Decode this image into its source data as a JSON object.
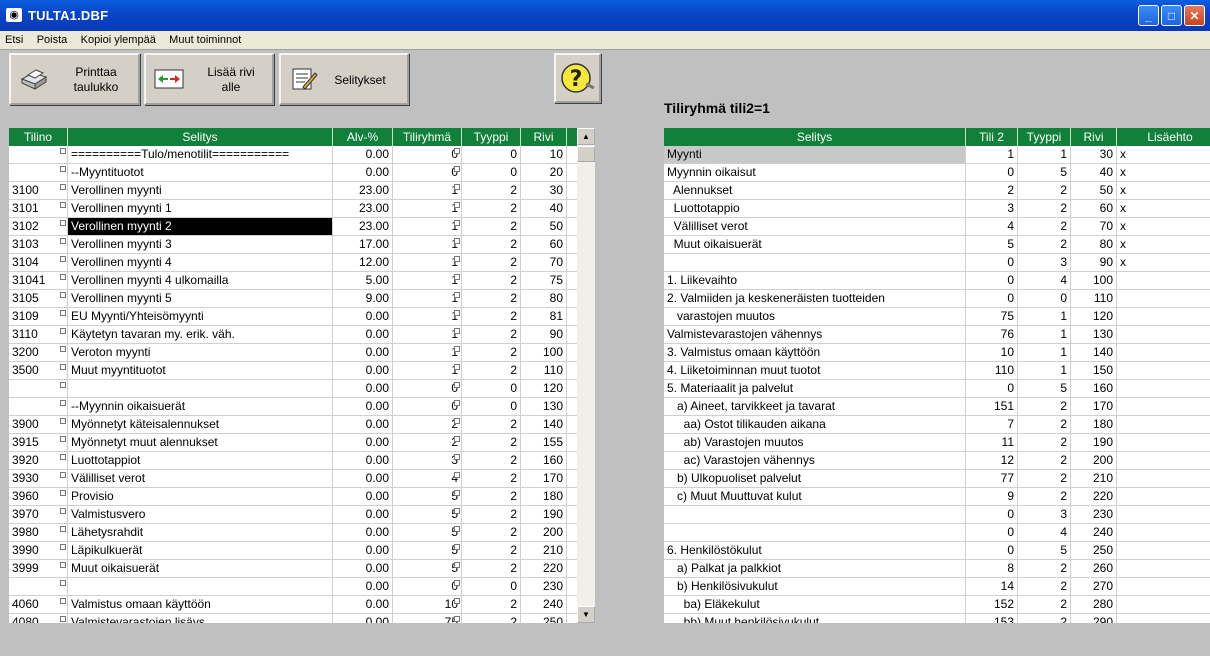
{
  "window": {
    "title": "TULTA1.DBF",
    "min": "_",
    "max": "□",
    "close": "✕"
  },
  "menu": [
    "Etsi",
    "Poista",
    "Kopioi ylempää",
    "Muut toiminnot"
  ],
  "toolbar": {
    "print": {
      "line1": "Printtaa",
      "line2": "taulukko"
    },
    "add": {
      "line1": "Lisää rivi",
      "line2": "alle"
    },
    "explain": {
      "label": "Selitykset"
    },
    "help": {
      "icon": "?"
    }
  },
  "right_title": "Tiliryhmä tili2=1",
  "left_table": {
    "columns": [
      "Tilino",
      "Selitys",
      "Alv-%",
      "Tiliryhmä",
      "Tyyppi",
      "Rivi"
    ],
    "selected_row": 4,
    "rows": [
      [
        "",
        "==========Tulo/menotilit===========",
        "0.00",
        "0",
        "0",
        "10"
      ],
      [
        "",
        "--Myyntituotot",
        "0.00",
        "0",
        "0",
        "20"
      ],
      [
        "3100",
        "Verollinen myynti",
        "23.00",
        "1",
        "2",
        "30"
      ],
      [
        "3101",
        "Verollinen myynti 1",
        "23.00",
        "1",
        "2",
        "40"
      ],
      [
        "3102",
        "Verollinen myynti 2",
        "23.00",
        "1",
        "2",
        "50"
      ],
      [
        "3103",
        "Verollinen myynti 3",
        "17.00",
        "1",
        "2",
        "60"
      ],
      [
        "3104",
        "Verollinen myynti 4",
        "12.00",
        "1",
        "2",
        "70"
      ],
      [
        "31041",
        "Verollinen myynti 4 ulkomailla",
        "5.00",
        "1",
        "2",
        "75"
      ],
      [
        "3105",
        "Verollinen myynti 5",
        "9.00",
        "1",
        "2",
        "80"
      ],
      [
        "3109",
        "EU Myynti/Yhteisömyynti",
        "0.00",
        "1",
        "2",
        "81"
      ],
      [
        "3110",
        "Käytetyn tavaran my. erik. väh.",
        "0.00",
        "1",
        "2",
        "90"
      ],
      [
        "3200",
        "Veroton myynti",
        "0.00",
        "1",
        "2",
        "100"
      ],
      [
        "3500",
        "Muut myyntituotot",
        "0.00",
        "1",
        "2",
        "110"
      ],
      [
        "",
        "",
        "0.00",
        "0",
        "0",
        "120"
      ],
      [
        "",
        "--Myynnin oikaisuerät",
        "0.00",
        "0",
        "0",
        "130"
      ],
      [
        "3900",
        "Myönnetyt käteisalennukset",
        "0.00",
        "2",
        "2",
        "140"
      ],
      [
        "3915",
        "Myönnetyt muut alennukset",
        "0.00",
        "2",
        "2",
        "155"
      ],
      [
        "3920",
        "Luottotappiot",
        "0.00",
        "3",
        "2",
        "160"
      ],
      [
        "3930",
        "Välilliset verot",
        "0.00",
        "4",
        "2",
        "170"
      ],
      [
        "3960",
        "Provisio",
        "0.00",
        "5",
        "2",
        "180"
      ],
      [
        "3970",
        "Valmistusvero",
        "0.00",
        "5",
        "2",
        "190"
      ],
      [
        "3980",
        "Lähetysrahdit",
        "0.00",
        "5",
        "2",
        "200"
      ],
      [
        "3990",
        "Läpikulkuerät",
        "0.00",
        "5",
        "2",
        "210"
      ],
      [
        "3999",
        "Muut oikaisuerät",
        "0.00",
        "5",
        "2",
        "220"
      ],
      [
        "",
        "",
        "0.00",
        "0",
        "0",
        "230"
      ],
      [
        "4060",
        "Valmistus omaan käyttöön",
        "0.00",
        "10",
        "2",
        "240"
      ],
      [
        "4080",
        "Valmistevarastojen lisäys",
        "0.00",
        "75",
        "2",
        "250"
      ]
    ]
  },
  "right_table": {
    "columns": [
      "Selitys",
      "Tili 2",
      "Tyyppi",
      "Rivi",
      "Lisäehto"
    ],
    "rows": [
      [
        "Myynti",
        "1",
        "1",
        "30",
        "x"
      ],
      [
        "Myynnin oikaisut",
        "0",
        "5",
        "40",
        "x"
      ],
      [
        "  Alennukset",
        "2",
        "2",
        "50",
        "x"
      ],
      [
        "  Luottotappio",
        "3",
        "2",
        "60",
        "x"
      ],
      [
        "  Välilliset verot",
        "4",
        "2",
        "70",
        "x"
      ],
      [
        "  Muut oikaisuerät",
        "5",
        "2",
        "80",
        "x"
      ],
      [
        "",
        "0",
        "3",
        "90",
        "x"
      ],
      [
        "1. Liikevaihto",
        "0",
        "4",
        "100",
        ""
      ],
      [
        "2. Valmiiden ja keskeneräisten tuotteiden",
        "0",
        "0",
        "110",
        ""
      ],
      [
        "   varastojen muutos",
        "75",
        "1",
        "120",
        ""
      ],
      [
        "Valmistevarastojen vähennys",
        "76",
        "1",
        "130",
        ""
      ],
      [
        "3. Valmistus omaan käyttöön",
        "10",
        "1",
        "140",
        ""
      ],
      [
        "4. Liiketoiminnan muut tuotot",
        "110",
        "1",
        "150",
        ""
      ],
      [
        "5. Materiaalit ja palvelut",
        "0",
        "5",
        "160",
        ""
      ],
      [
        "   a) Aineet, tarvikkeet ja tavarat",
        "151",
        "2",
        "170",
        ""
      ],
      [
        "     aa) Ostot tilikauden aikana",
        "7",
        "2",
        "180",
        ""
      ],
      [
        "     ab) Varastojen muutos",
        "11",
        "2",
        "190",
        ""
      ],
      [
        "     ac) Varastojen vähennys",
        "12",
        "2",
        "200",
        ""
      ],
      [
        "   b) Ulkopuoliset palvelut",
        "77",
        "2",
        "210",
        ""
      ],
      [
        "   c) Muut Muuttuvat kulut",
        "9",
        "2",
        "220",
        ""
      ],
      [
        "",
        "0",
        "3",
        "230",
        ""
      ],
      [
        "",
        "0",
        "4",
        "240",
        ""
      ],
      [
        "6. Henkilöstökulut",
        "0",
        "5",
        "250",
        ""
      ],
      [
        "   a) Palkat ja palkkiot",
        "8",
        "2",
        "260",
        ""
      ],
      [
        "   b) Henkilösivukulut",
        "14",
        "2",
        "270",
        ""
      ],
      [
        "     ba) Eläkekulut",
        "152",
        "2",
        "280",
        ""
      ],
      [
        "     bb) Muut henkilösivukulut",
        "153",
        "2",
        "290",
        ""
      ]
    ]
  }
}
